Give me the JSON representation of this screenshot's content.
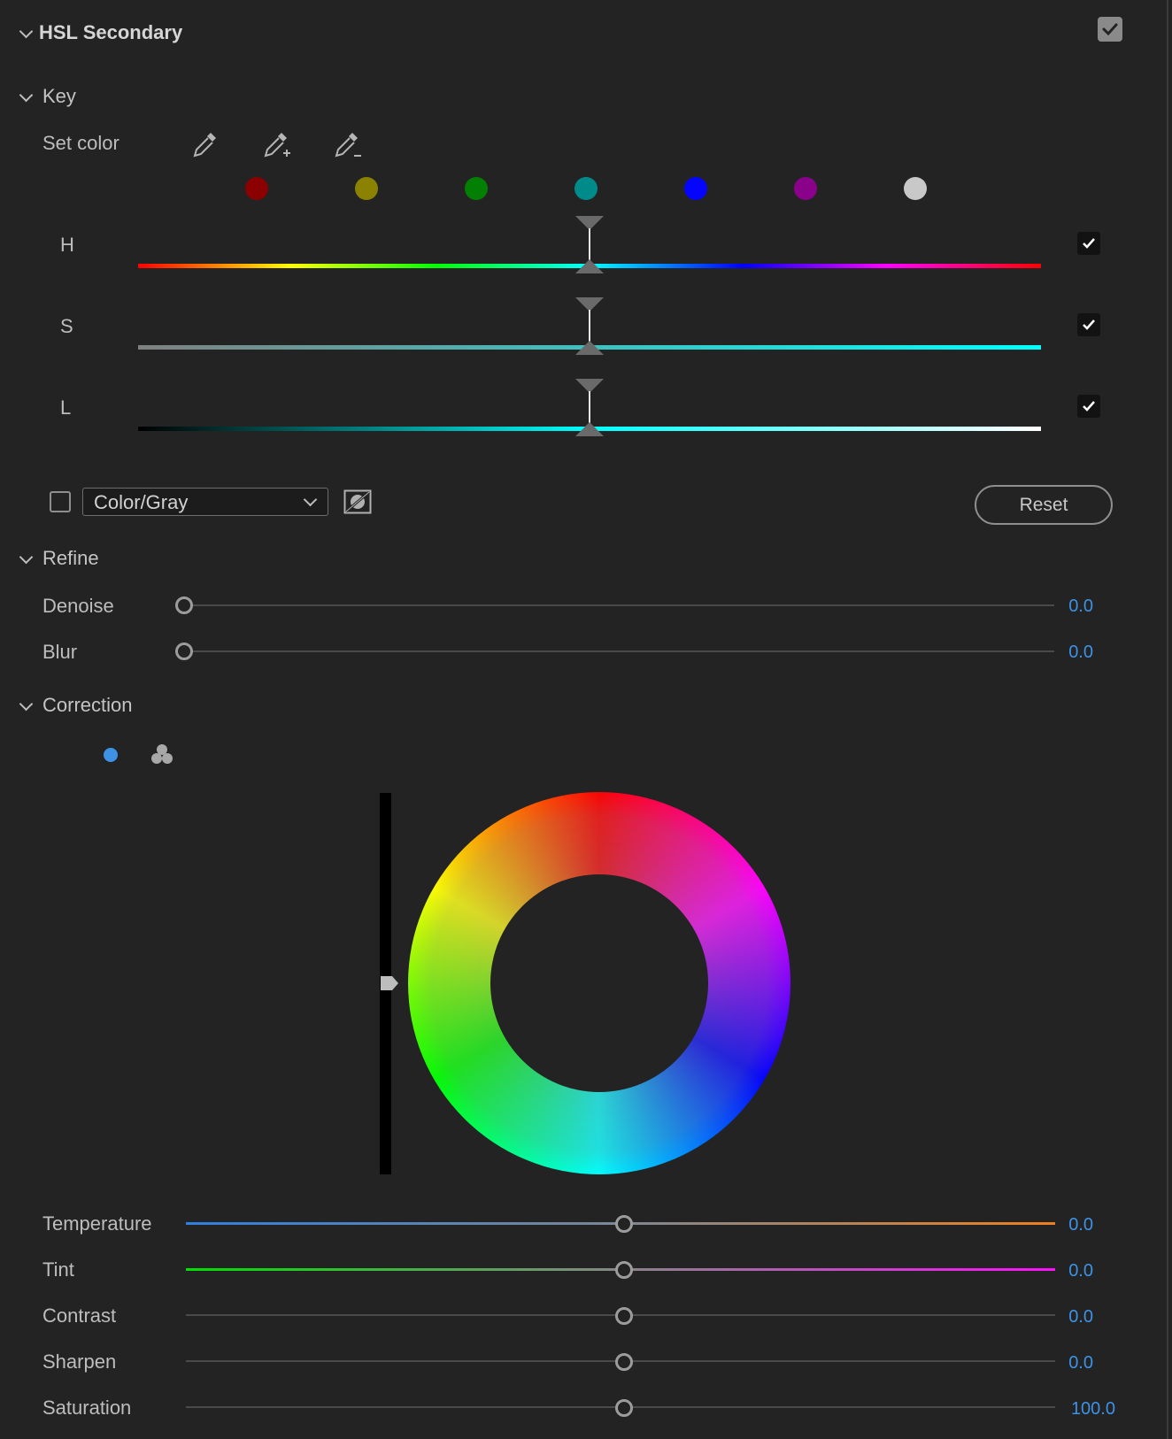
{
  "panel": {
    "title": "HSL Secondary",
    "enabled": true
  },
  "key": {
    "heading": "Key",
    "set_color_label": "Set color",
    "eyedroppers": [
      "eyedropper-icon",
      "eyedropper-add-icon",
      "eyedropper-subtract-icon"
    ],
    "swatches": [
      {
        "name": "red",
        "color": "#8b0000"
      },
      {
        "name": "yellow",
        "color": "#8a8200"
      },
      {
        "name": "green",
        "color": "#038003"
      },
      {
        "name": "cyan",
        "color": "#008b8b"
      },
      {
        "name": "blue",
        "color": "#0404ff"
      },
      {
        "name": "magenta",
        "color": "#8a028a"
      },
      {
        "name": "white",
        "color": "#c8c8c8"
      }
    ],
    "sliders": [
      {
        "label": "H",
        "checked": true
      },
      {
        "label": "S",
        "checked": true
      },
      {
        "label": "L",
        "checked": true
      }
    ],
    "display_mode": "Color/Gray",
    "reset_label": "Reset"
  },
  "refine": {
    "heading": "Refine",
    "controls": [
      {
        "label": "Denoise",
        "value": "0.0"
      },
      {
        "label": "Blur",
        "value": "0.0"
      }
    ]
  },
  "correction": {
    "heading": "Correction",
    "controls": [
      {
        "label": "Temperature",
        "value": "0.0"
      },
      {
        "label": "Tint",
        "value": "0.0"
      },
      {
        "label": "Contrast",
        "value": "0.0"
      },
      {
        "label": "Sharpen",
        "value": "0.0"
      },
      {
        "label": "Saturation",
        "value": "100.0"
      }
    ]
  },
  "colors": {
    "accent": "#3d92e6",
    "background": "#232323"
  }
}
